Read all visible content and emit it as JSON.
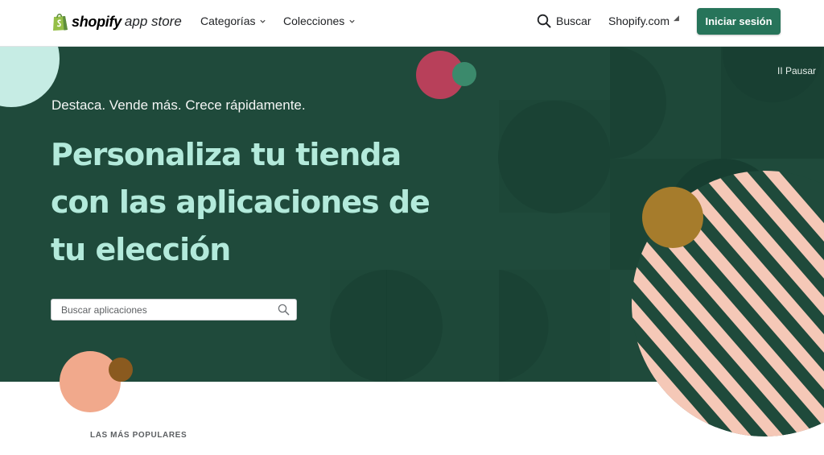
{
  "header": {
    "logo_word": "shopify",
    "logo_sub": "app store",
    "nav": {
      "categories": "Categorías",
      "collections": "Colecciones",
      "search": "Buscar",
      "shopify_com": "Shopify.com",
      "login": "Iniciar sesión"
    },
    "icons": [
      "shopify-bag-icon",
      "chevron-down-icon",
      "search-icon",
      "external-link-icon"
    ]
  },
  "hero": {
    "pause": "II Pausar",
    "tagline": "Destaca. Vende más. Crece rápidamente.",
    "headline": "Personaliza tu tienda con las aplicaciones de tu elección",
    "search": {
      "placeholder": "Buscar aplicaciones",
      "value": ""
    },
    "colors": {
      "background": "#1f4a3b",
      "headline": "#b3eadb",
      "accent_pink": "#b8405a",
      "accent_green": "#3b8a6c",
      "accent_mustard": "#a67c2c",
      "accent_peach": "#f1a98c",
      "stripes": "#f5c8b7"
    }
  },
  "sections": {
    "popular_label": "LAS MÁS POPULARES"
  },
  "brand": {
    "primary_button": "#27745a"
  }
}
